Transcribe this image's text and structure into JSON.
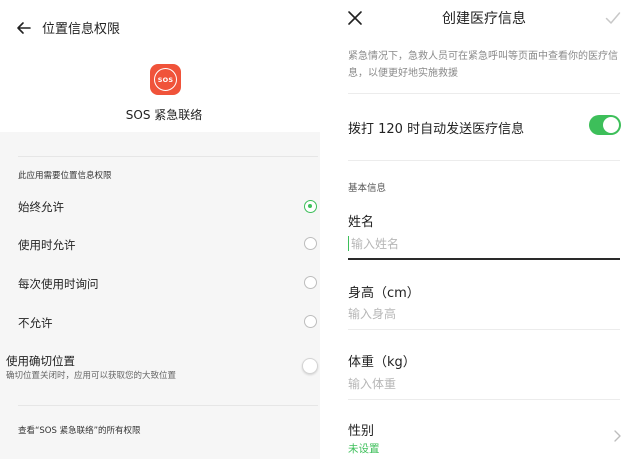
{
  "left": {
    "title": "位置信息权限",
    "app_name": "SOS 紧急联络",
    "app_icon_text": "SOS",
    "section_title": "此应用需要位置信息权限",
    "options": [
      {
        "label": "始终允许",
        "selected": true
      },
      {
        "label": "使用时允许",
        "selected": false
      },
      {
        "label": "每次使用时询问",
        "selected": false
      },
      {
        "label": "不允许",
        "selected": false
      }
    ],
    "precise": {
      "title": "使用确切位置",
      "desc": "确切位置关闭时，应用可以获取您的大致位置",
      "enabled": false
    },
    "all_permissions": "查看“SOS 紧急联络”的所有权限"
  },
  "right": {
    "title": "创建医疗信息",
    "description": "紧急情况下，急救人员可在紧急呼叫等页面中查看你的医疗信息，以便更好地实施救援",
    "auto_send_label": "拨打 120 时自动发送医疗信息",
    "auto_send_enabled": true,
    "basic_section": "基本信息",
    "fields": {
      "name": {
        "label": "姓名",
        "placeholder": "输入姓名",
        "value": ""
      },
      "height": {
        "label": "身高（cm）",
        "placeholder": "输入身高",
        "value": ""
      },
      "weight": {
        "label": "体重（kg）",
        "placeholder": "输入体重",
        "value": ""
      }
    },
    "gender": {
      "label": "性别",
      "value": "未设置"
    }
  },
  "colors": {
    "accent": "#3dbf5a",
    "app_icon": "#f0533a"
  }
}
